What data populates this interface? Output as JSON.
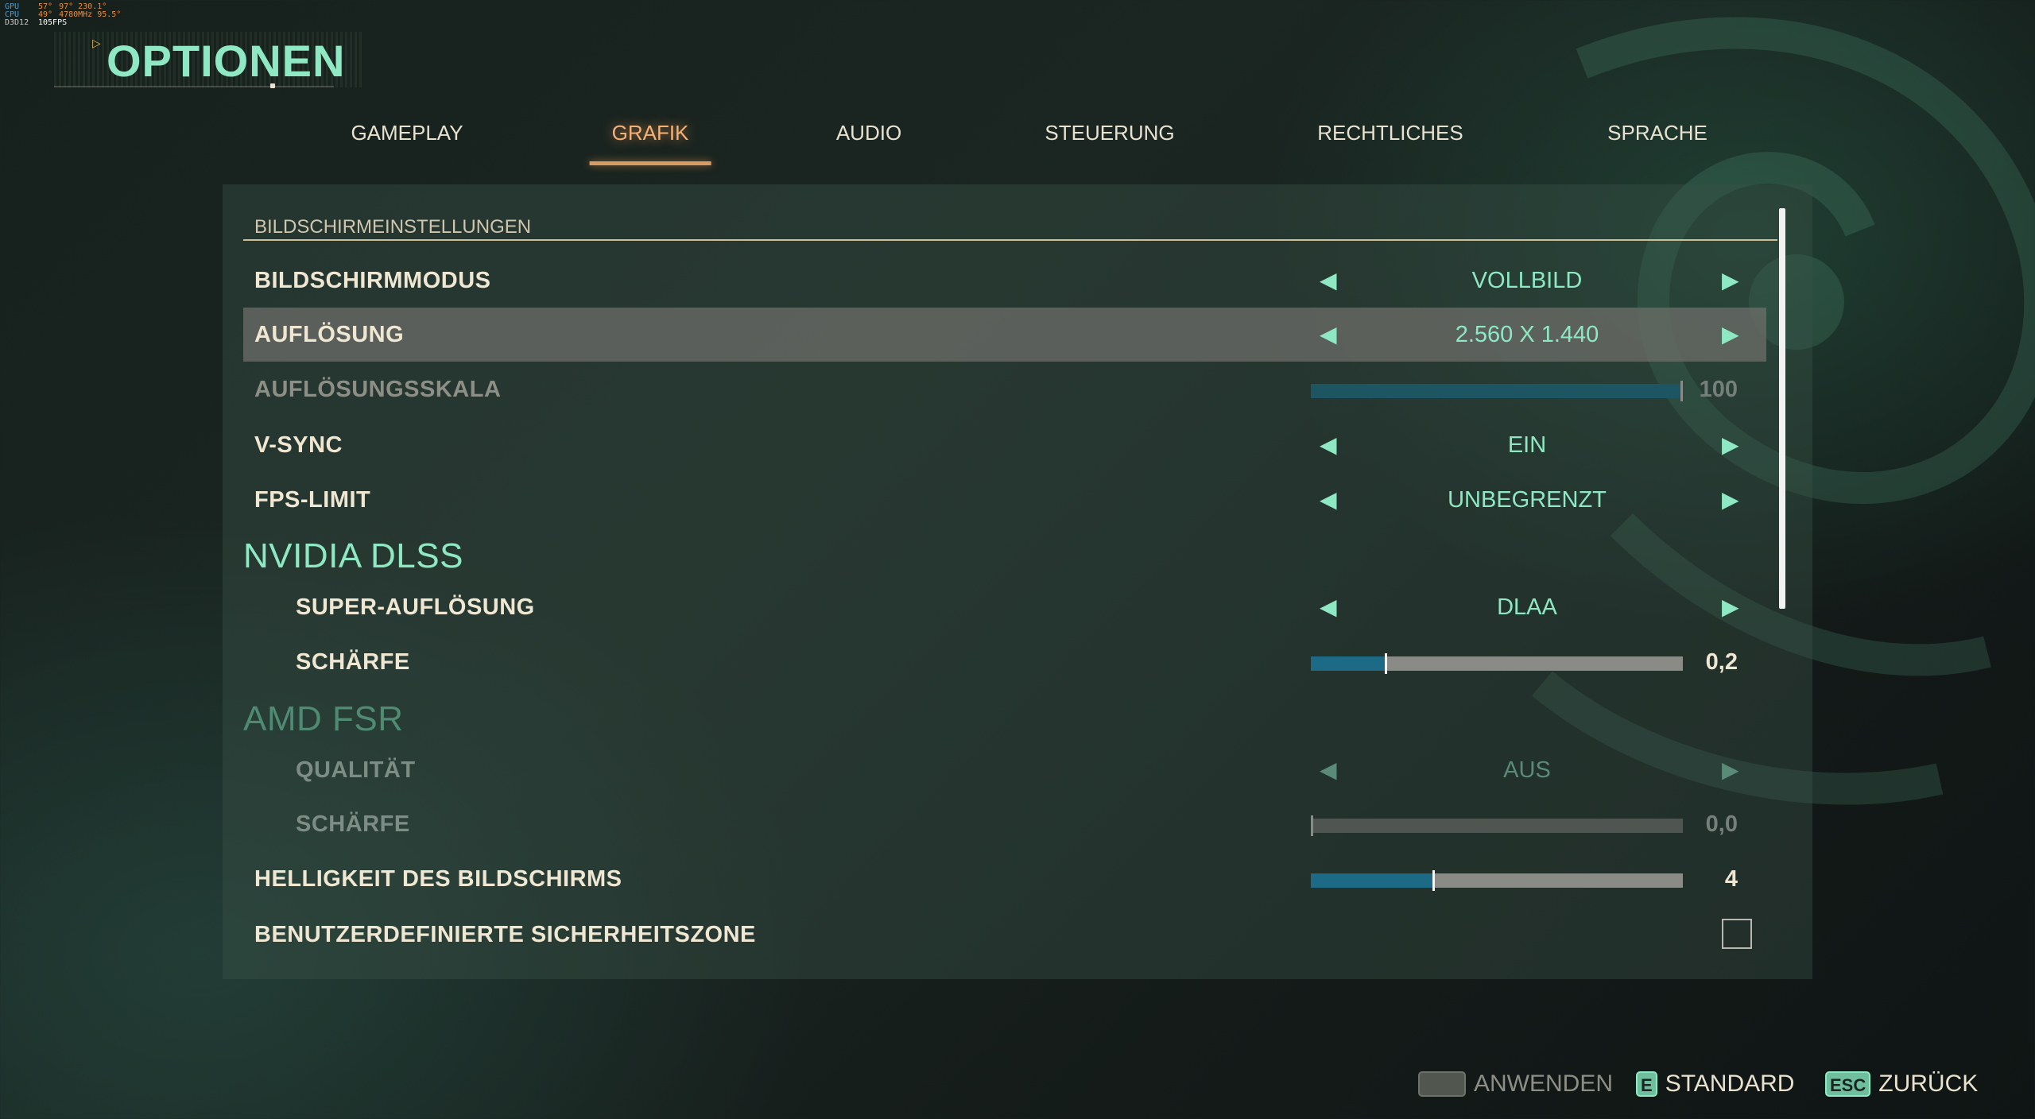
{
  "hud": {
    "rows": [
      {
        "label": "GPU",
        "v1": "57°",
        "v2": "97°  230.1°"
      },
      {
        "label": "CPU",
        "v1": "49°",
        "v2": "4780MHz 95.5°"
      },
      {
        "label": "D3D12",
        "v1": "105FPS",
        "v2": ""
      }
    ]
  },
  "page": {
    "title": "OPTIONEN"
  },
  "tabs": [
    "GAMEPLAY",
    "GRAFIK",
    "AUDIO",
    "STEUERUNG",
    "RECHTLICHES",
    "SPRACHE"
  ],
  "active_tab": "GRAFIK",
  "section": {
    "title": "BILDSCHIRMEINSTELLUNGEN"
  },
  "settings": {
    "display_mode": {
      "label": "BILDSCHIRMMODUS",
      "value": "VOLLBILD"
    },
    "resolution": {
      "label": "AUFLÖSUNG",
      "value": "2.560 X 1.440"
    },
    "resolution_scale": {
      "label": "AUFLÖSUNGSSKALA",
      "value": "100",
      "fraction": 1.0
    },
    "vsync": {
      "label": "V-SYNC",
      "value": "EIN"
    },
    "fps_limit": {
      "label": "FPS-LIMIT",
      "value": "UNBEGRENZT"
    },
    "dlss_heading": "NVIDIA DLSS",
    "dlss_super_resolution": {
      "label": "SUPER-AUFLÖSUNG",
      "value": "DLAA"
    },
    "dlss_sharpness": {
      "label": "SCHÄRFE",
      "value": "0,2",
      "fraction": 0.2
    },
    "fsr_heading": "AMD FSR",
    "fsr_quality": {
      "label": "QUALITÄT",
      "value": "AUS"
    },
    "fsr_sharpness": {
      "label": "SCHÄRFE",
      "value": "0,0",
      "fraction": 0.0
    },
    "brightness": {
      "label": "HELLIGKEIT DES BILDSCHIRMS",
      "value": "4",
      "fraction": 0.33
    },
    "safe_zone": {
      "label": "BENUTZERDEFINIERTE SICHERHEITSZONE",
      "checked": false
    }
  },
  "footer": {
    "apply": {
      "key": "",
      "label": "ANWENDEN"
    },
    "default": {
      "key": "E",
      "label": "STANDARD"
    },
    "back": {
      "key": "ESC",
      "label": "ZURÜCK"
    }
  },
  "colors": {
    "accent": "#8ee8c3",
    "active_tab": "#f2b178",
    "slider_fill": "#1d6a86"
  }
}
